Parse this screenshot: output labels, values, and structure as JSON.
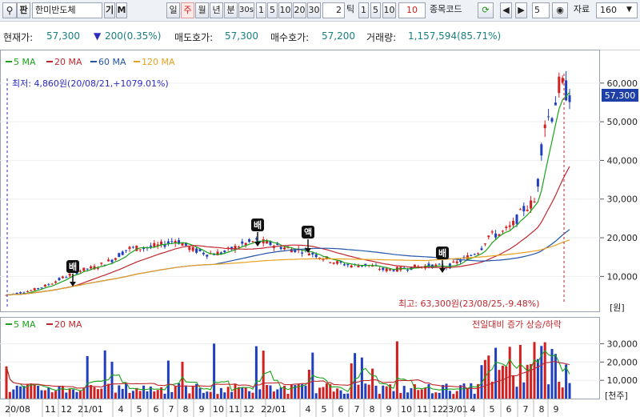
{
  "toolbar": {
    "search_icon": "search-icon",
    "type_label": "판",
    "stock_name": "한미반도체",
    "ki_label": "기",
    "m_label": "M",
    "period_tabs": [
      "일",
      "주",
      "월",
      "년",
      "분",
      "30s"
    ],
    "selected_period": "주",
    "count_buttons_a": [
      "1",
      "5",
      "10",
      "20",
      "30"
    ],
    "tick_value": "2",
    "tick_label": "틱",
    "count_buttons_b": [
      "1",
      "5",
      "10"
    ],
    "red_value": "10",
    "code_label": "종목코드",
    "step_value": "5",
    "data_label": "자료",
    "data_count": "160"
  },
  "quote": {
    "price_label": "현재가:",
    "price": "57,300",
    "change": "200(0.35%)",
    "ask_label": "매도호가:",
    "ask": "57,300",
    "bid_label": "매수호가:",
    "bid": "57,200",
    "volume_label": "거래량:",
    "volume": "1,157,594(85.71%)"
  },
  "price_panel": {
    "legend": [
      {
        "label": "5 MA",
        "color": "#1aa31a"
      },
      {
        "label": "20 MA",
        "color": "#c0272d"
      },
      {
        "label": "60 MA",
        "color": "#2354a8"
      },
      {
        "label": "120 MA",
        "color": "#e8a020"
      }
    ],
    "low_text": "최저: 4,860원(20/08/21,+1079.01%)",
    "high_text": "최고: 63,300원(23/08/25,-9.48%)",
    "current_tag": "57,300",
    "unit": "[원]",
    "markers": [
      "배",
      "배",
      "액",
      "배"
    ]
  },
  "volume_panel": {
    "legend": [
      {
        "label": "5 MA",
        "color": "#1aa31a"
      },
      {
        "label": "20 MA",
        "color": "#c0272d"
      }
    ],
    "note": "전일대비 증가 상승/하락",
    "unit": "[천주]"
  },
  "chart_data": {
    "type": "candlestick",
    "price_axis": {
      "ylim": [
        2000,
        67000
      ],
      "ticks": [
        "60,000",
        "50,000",
        "40,000",
        "30,000",
        "20,000",
        "10,000"
      ],
      "tick_values": [
        60000,
        50000,
        40000,
        30000,
        20000,
        10000
      ]
    },
    "volume_axis": {
      "ylim": [
        0,
        42000
      ],
      "ticks": [
        "30,000",
        "20,000",
        "10,000"
      ],
      "tick_values": [
        30000,
        20000,
        10000
      ]
    },
    "x_labels": [
      "20/08",
      "11",
      "12",
      "21/01",
      "4",
      "5",
      "6",
      "7",
      "8",
      "9",
      "10",
      "11",
      "12",
      "22/01",
      "4",
      "5",
      "6",
      "7",
      "8",
      "9",
      "10",
      "11",
      "12",
      "23/01",
      "4",
      "5",
      "6",
      "7",
      "8",
      "9"
    ],
    "current_price": 57300,
    "low": 4860,
    "high": 63300
  }
}
